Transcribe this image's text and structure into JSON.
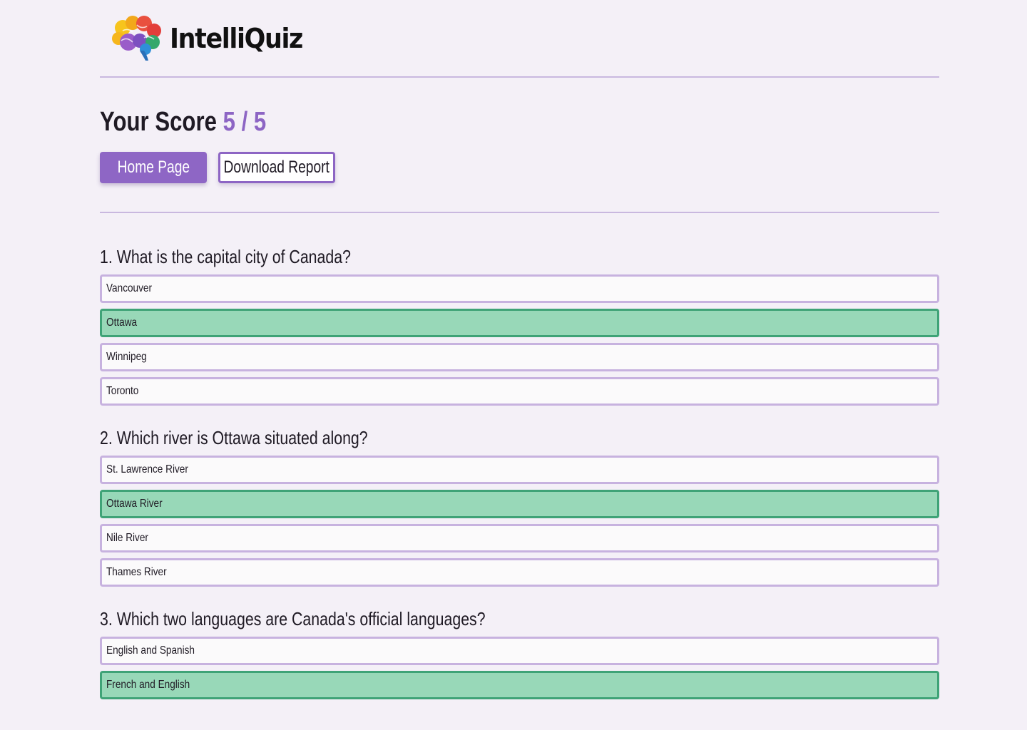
{
  "brand": {
    "name": "IntelliQuiz",
    "logo_icon": "brain-icon"
  },
  "score": {
    "label": "Your Score",
    "value": "5 / 5"
  },
  "actions": {
    "home_label": "Home Page",
    "download_label": "Download Report"
  },
  "colors": {
    "accent": "#8e66c5",
    "correct_bg": "#98d8b8",
    "correct_border": "#3fa377",
    "option_border": "#c7b2df",
    "page_bg": "#f4f0f7"
  },
  "questions": [
    {
      "text": "1. What is the capital city of Canada?",
      "options": [
        {
          "label": "Vancouver",
          "correct": false
        },
        {
          "label": "Ottawa",
          "correct": true
        },
        {
          "label": "Winnipeg",
          "correct": false
        },
        {
          "label": "Toronto",
          "correct": false
        }
      ]
    },
    {
      "text": "2. Which river is Ottawa situated along?",
      "options": [
        {
          "label": "St. Lawrence River",
          "correct": false
        },
        {
          "label": "Ottawa River",
          "correct": true
        },
        {
          "label": "Nile River",
          "correct": false
        },
        {
          "label": "Thames River",
          "correct": false
        }
      ]
    },
    {
      "text": "3. Which two languages are Canada's official languages?",
      "options": [
        {
          "label": "English and Spanish",
          "correct": false
        },
        {
          "label": "French and English",
          "correct": true
        }
      ]
    }
  ]
}
